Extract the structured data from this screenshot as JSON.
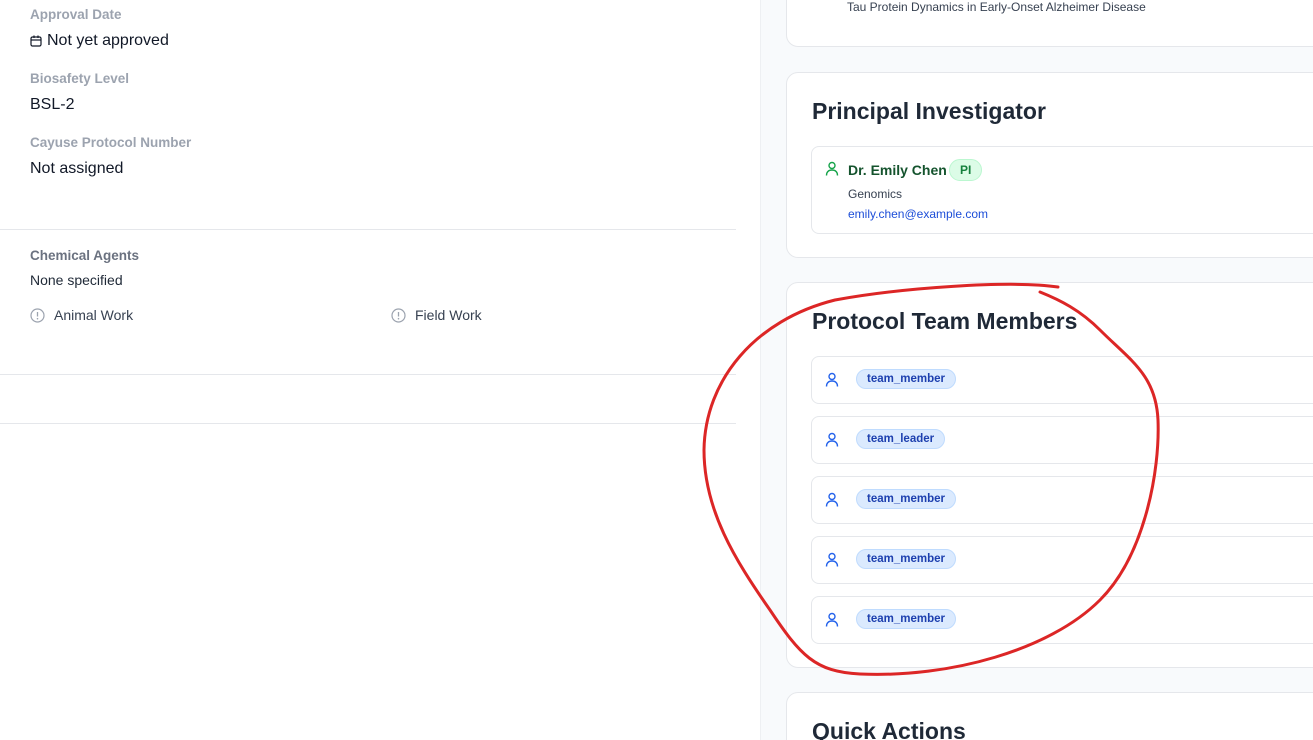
{
  "details": {
    "approval_date_label": "Approval Date",
    "approval_date_value": "Not yet approved",
    "biosafety_label": "Biosafety Level",
    "biosafety_value": "BSL-2",
    "cayuse_label": "Cayuse Protocol Number",
    "cayuse_value": "Not assigned",
    "chemical_label": "Chemical Agents",
    "chemical_value": "None specified",
    "animal_work_label": "Animal Work",
    "field_work_label": "Field Work"
  },
  "protocol": {
    "title_text": "Tau Protein Dynamics in Early-Onset Alzheimer Disease"
  },
  "pi": {
    "heading": "Principal Investigator",
    "name": "Dr. Emily Chen",
    "badge": "PI",
    "department": "Genomics",
    "email": "emily.chen@example.com"
  },
  "team": {
    "heading": "Protocol Team Members",
    "members": [
      {
        "role": "team_member"
      },
      {
        "role": "team_leader"
      },
      {
        "role": "team_member"
      },
      {
        "role": "team_member"
      },
      {
        "role": "team_member"
      }
    ]
  },
  "quick_actions": {
    "heading": "Quick Actions"
  },
  "colors": {
    "pi_icon": "#16a34a",
    "member_icon": "#2563eb",
    "annotation": "#dc2626"
  },
  "icons": {
    "approval_date": "calendar-icon",
    "animal_work": "info-circle-icon",
    "field_work": "info-circle-icon",
    "pi": "user-icon",
    "member": "user-icon"
  }
}
